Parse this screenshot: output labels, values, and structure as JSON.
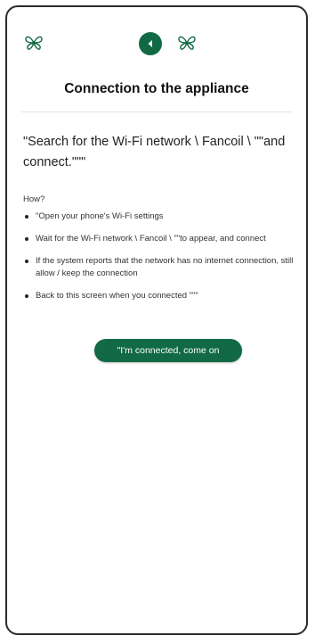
{
  "header": {
    "left_icon": "butterfly-logo-icon",
    "back_icon": "back-arrow-icon",
    "right_icon": "butterfly-logo-icon",
    "accent_color": "#116a44"
  },
  "title": "Connection to the appliance",
  "instruction": "\"Search for the Wi-Fi network \\ Fancoil \\ \"\"and connect.\"\"\"",
  "how_label": "How?",
  "steps": [
    "\"Open your phone's Wi-Fi settings",
    "Wait for the Wi-Fi network \\ Fancoil \\ \"\"to appear, and connect",
    "If the system reports that the network has no internet connection, still allow / keep the connection",
    "Back to this screen when you connected \"\"\""
  ],
  "connect_button": "\"I'm connected, come on"
}
